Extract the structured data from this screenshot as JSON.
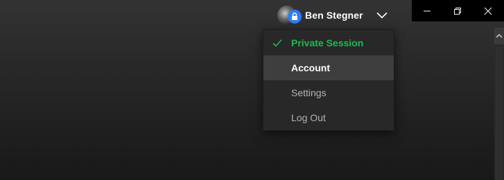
{
  "user": {
    "name": "Ben Stegner",
    "avatar_icon": "avatar-with-lock-icon",
    "lock_color": "#2f7cf6"
  },
  "menu": {
    "items": [
      {
        "label": "Private Session",
        "checked": true,
        "state": "active"
      },
      {
        "label": "Account",
        "checked": false,
        "state": "hover"
      },
      {
        "label": "Settings",
        "checked": false,
        "state": "normal"
      },
      {
        "label": "Log Out",
        "checked": false,
        "state": "normal"
      }
    ]
  },
  "window_controls": {
    "minimize_icon": "minimize-icon",
    "restore_icon": "restore-icon",
    "close_icon": "close-icon"
  },
  "colors": {
    "accent_green": "#1db954",
    "menu_bg": "#282828",
    "menu_hover": "#3e3e3e",
    "titlebar_bg": "#000000"
  }
}
